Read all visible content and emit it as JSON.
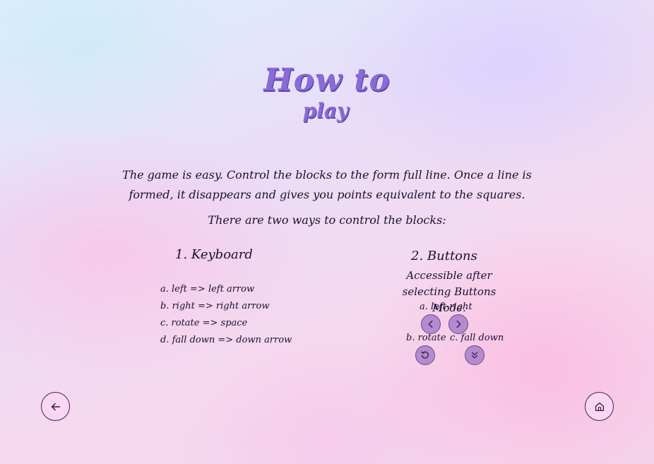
{
  "header": {
    "title_line1": "How to",
    "title_line2": "play"
  },
  "intro": {
    "text": "The game is easy. Control the blocks to the form full line. Once a line is formed, it disappears and gives you points equivalent to the squares.",
    "ways": "There are two ways to control the blocks:"
  },
  "keyboard": {
    "title": "1.  Keyboard",
    "items": [
      "a. left => left arrow",
      "b. right => right arrow",
      "c. rotate => space",
      "d. fall down => down arrow"
    ]
  },
  "buttons": {
    "title": "2.  Buttons",
    "description": "Accessible after selecting Buttons Mode.",
    "label_left_right": "a. left-right",
    "label_rotate": "b. rotate",
    "label_fall_down": "c. fall down"
  },
  "icons": {
    "left": "chevron-left-icon",
    "right": "chevron-right-icon",
    "rotate": "rotate-icon",
    "fall_down": "double-chevron-down-icon",
    "back": "arrow-left-icon",
    "home": "home-icon"
  },
  "colors": {
    "title": "#8a6ad6",
    "control_button": "#b58ad0",
    "nav_button": "#fbd6f4"
  }
}
